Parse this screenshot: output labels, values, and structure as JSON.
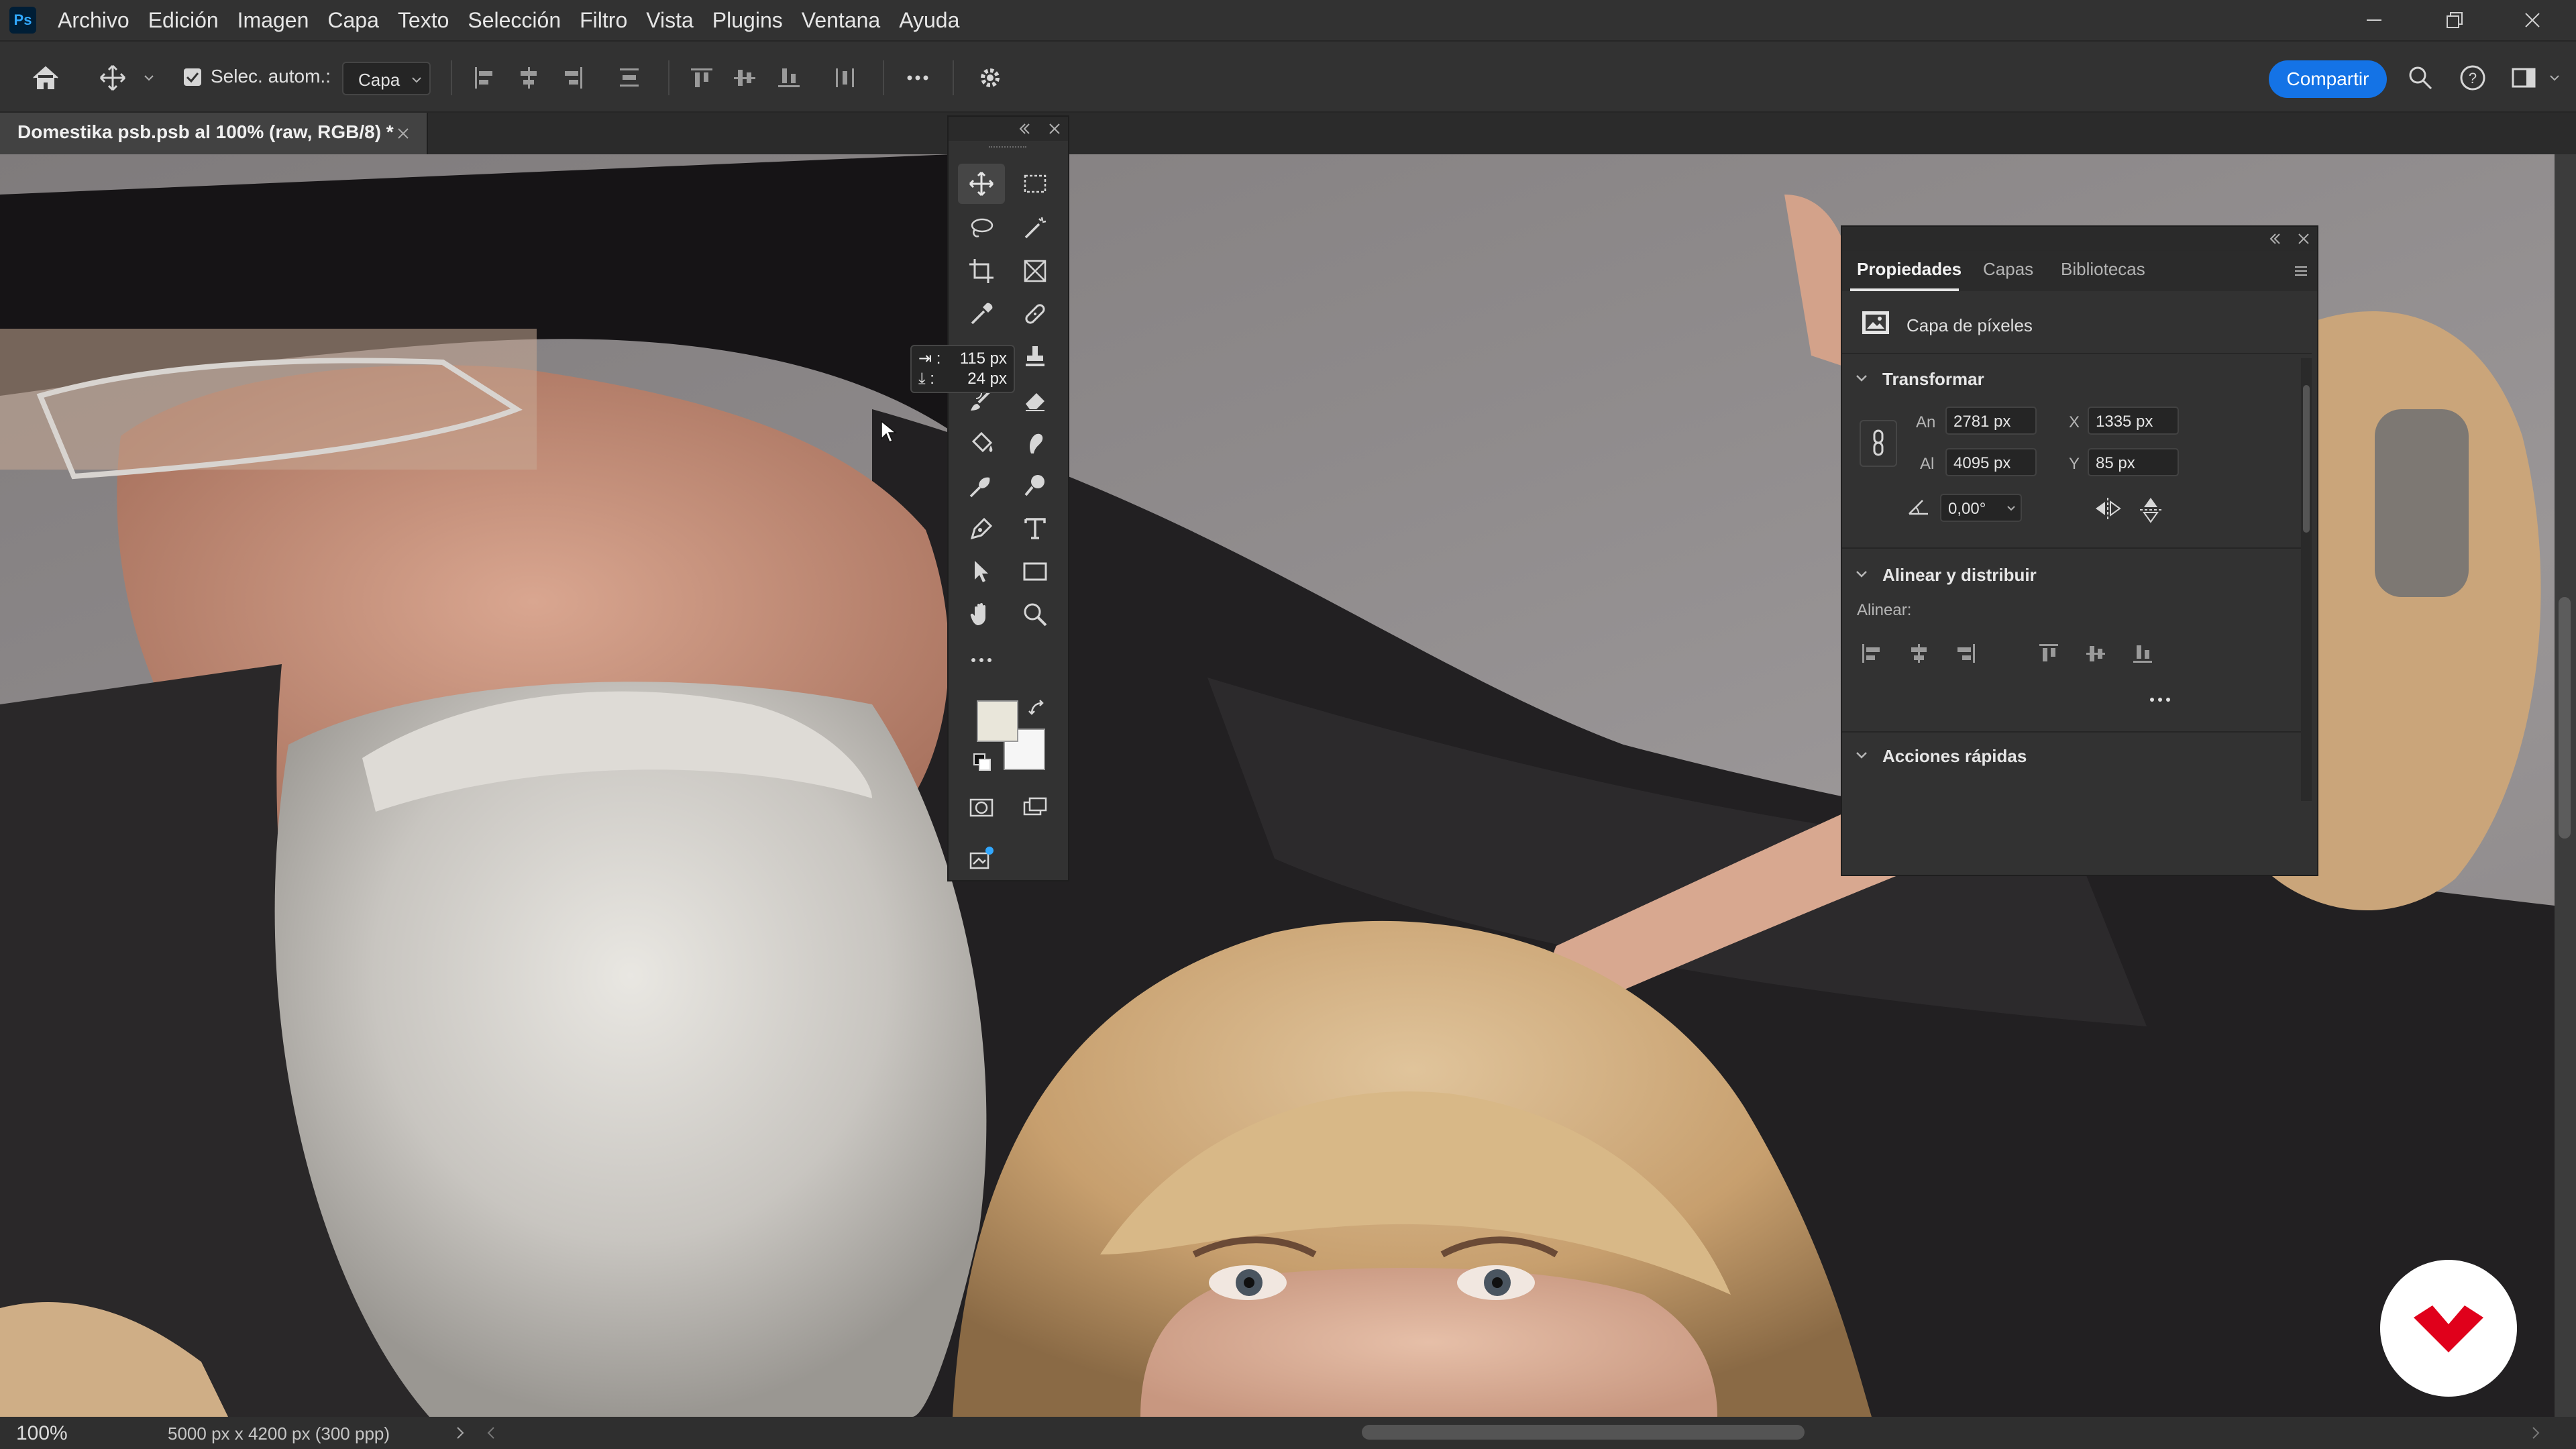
{
  "app": {
    "logo": "Ps",
    "menu": [
      "Archivo",
      "Edición",
      "Imagen",
      "Capa",
      "Texto",
      "Selección",
      "Filtro",
      "Vista",
      "Plugins",
      "Ventana",
      "Ayuda"
    ]
  },
  "options_bar": {
    "auto_select_label": "Selec. autom.:",
    "auto_select_checked": true,
    "layer_select_value": "Capa",
    "share_label": "Compartir"
  },
  "document": {
    "tab_title": "Domestika psb.psb al 100% (raw, RGB/8) *",
    "zoom": "100%",
    "size_info": "5000 px x 4200 px (300 ppp)"
  },
  "measure_tooltip": {
    "h": "115 px",
    "v": "24 px"
  },
  "tools": {
    "foreground_color": "#e9e6da",
    "background_color": "#f6f6f6",
    "icons": [
      "move-tool-icon",
      "marquee-tool-icon",
      "lasso-tool-icon",
      "magic-wand-tool-icon",
      "crop-tool-icon",
      "frame-tool-icon",
      "eyedropper-tool-icon",
      "healing-brush-tool-icon",
      "brush-tool-icon",
      "stamp-tool-icon",
      "history-brush-tool-icon",
      "eraser-tool-icon",
      "paint-bucket-tool-icon",
      "smudge-tool-icon",
      "dodge-tool-icon",
      "zoom-search-icon",
      "pen-tool-icon",
      "type-tool-icon",
      "path-selection-tool-icon",
      "rectangle-tool-icon",
      "hand-tool-icon",
      "zoom-tool-icon",
      "more-tools-icon"
    ]
  },
  "properties_panel": {
    "tabs": [
      "Propiedades",
      "Capas",
      "Bibliotecas"
    ],
    "layer_type": "Capa de píxeles",
    "transform": {
      "title": "Transformar",
      "width_label": "An",
      "width": "2781 px",
      "height_label": "Al",
      "height": "4095 px",
      "x_label": "X",
      "x": "1335 px",
      "y_label": "Y",
      "y": "85 px",
      "angle": "0,00°"
    },
    "align": {
      "title": "Alinear y distribuir",
      "subtitle": "Alinear:"
    },
    "quick_actions": {
      "title": "Acciones rápidas"
    }
  },
  "colors": {
    "accent": "#1473e6",
    "ui_dark": "#323232",
    "watermark": "#e0001b"
  }
}
